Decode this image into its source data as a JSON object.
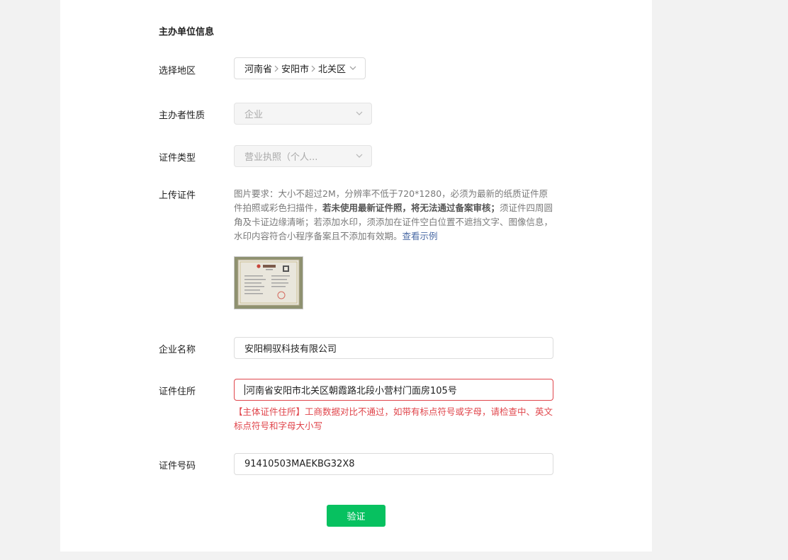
{
  "section": {
    "title": "主办单位信息"
  },
  "region": {
    "label": "选择地区",
    "province": "河南省",
    "city": "安阳市",
    "district": "北关区"
  },
  "organizer_type": {
    "label": "主办者性质",
    "value": "企业"
  },
  "cert_type": {
    "label": "证件类型",
    "value": "营业执照（个人..."
  },
  "upload": {
    "label": "上传证件",
    "help_part1": "图片要求：大小不超过2M，分辨率不低于720*1280，必须为最新的纸质证件原件拍照或彩色扫描件，",
    "help_bold": "若未使用最新证件照，将无法通过备案审核；",
    "help_part2": "须证件四周圆角及卡证边缘清晰；若添加水印，须添加在证件空白位置不遮挡文字、图像信息，水印内容符合小程序备案且不添加有效期。",
    "help_link": "查看示例"
  },
  "company_name": {
    "label": "企业名称",
    "value": "安阳桐驭科技有限公司"
  },
  "cert_address": {
    "label": "证件住所",
    "value": "河南省安阳市北关区朝霞路北段小营村门面房105号",
    "error": "【主体证件住所】工商数据对比不通过，如带有标点符号或字母，请检查中、英文标点符号和字母大小写"
  },
  "cert_number": {
    "label": "证件号码",
    "value": "91410503MAEKBG32X8"
  },
  "verify_button": {
    "label": "验证"
  },
  "colors": {
    "accent": "#07c160",
    "error": "#e0454b",
    "link": "#4a6aa5"
  }
}
